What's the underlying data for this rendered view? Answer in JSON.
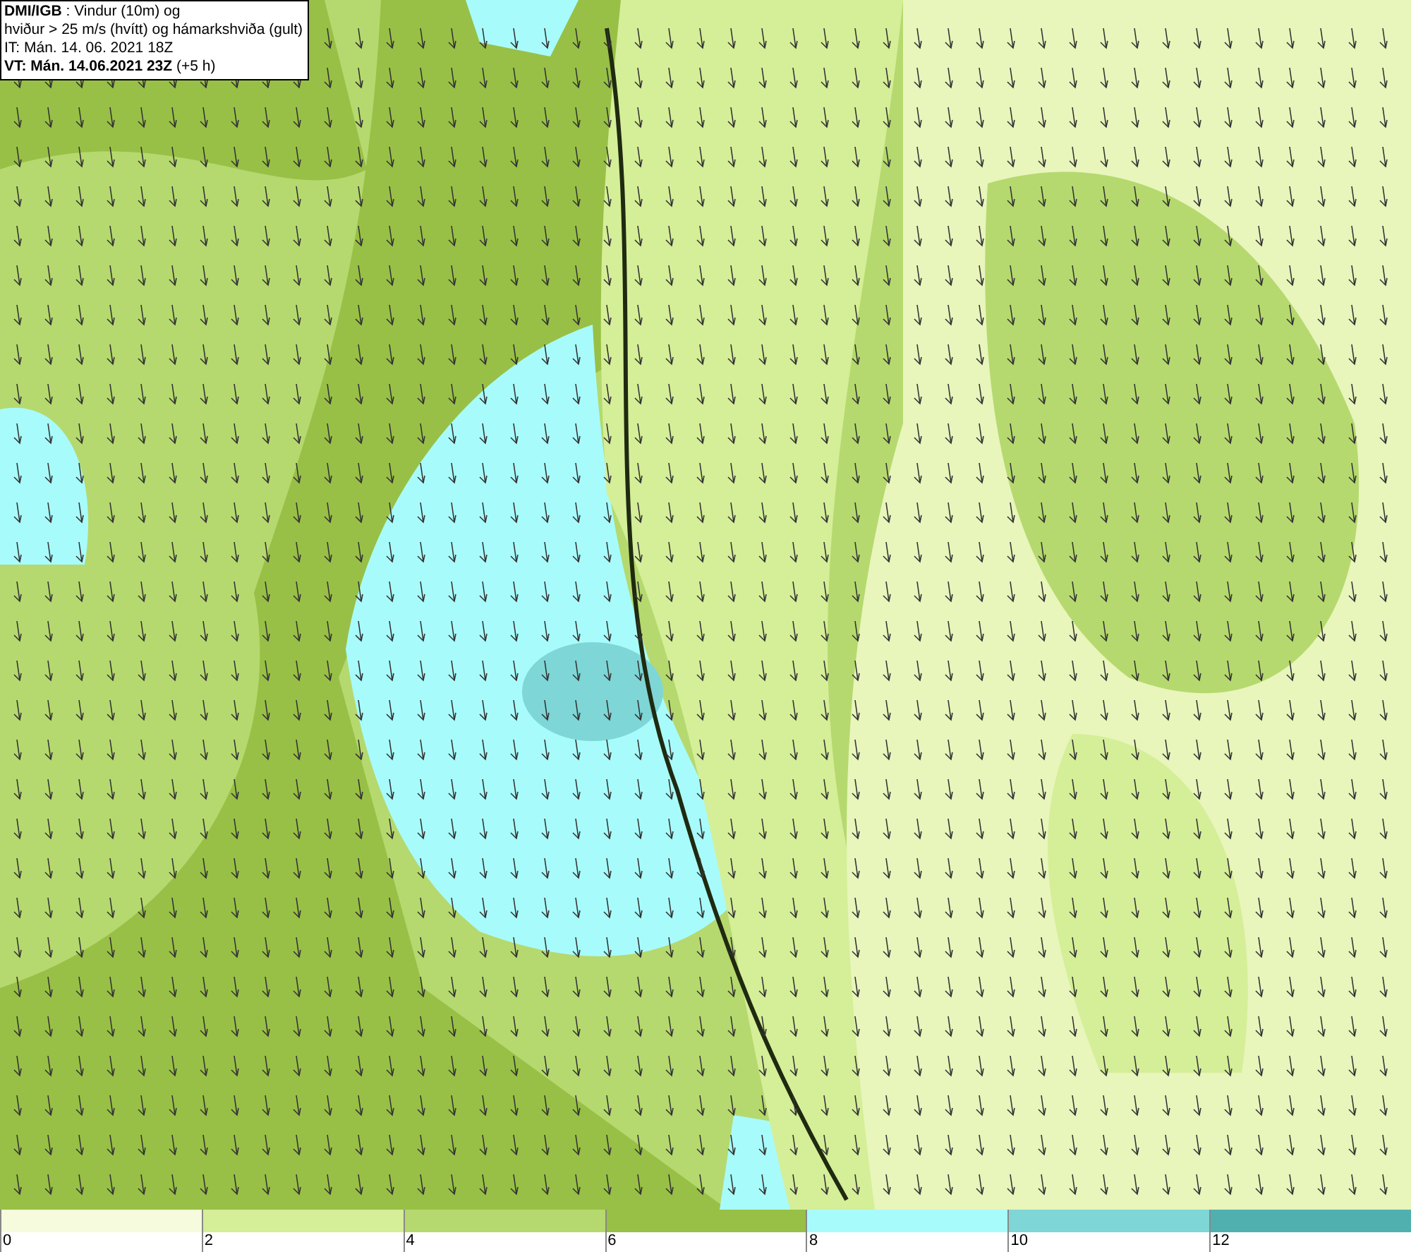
{
  "header": {
    "lines": [
      "**DMI/IGB** : Vindur (10m) og",
      "hviður > 25 m/s (hvítt) og hámarkshviða (gult)",
      "IT: Mán. 14. 06. 2021 18Z",
      "**VT: Mán. 14.06.2021 23Z** (+5 h)"
    ]
  },
  "legend": [
    {
      "label": "0",
      "color": "#f5fbdc"
    },
    {
      "label": "2",
      "color": "#d5ee98"
    },
    {
      "label": "4",
      "color": "#b5d96e"
    },
    {
      "label": "6",
      "color": "#98c046"
    },
    {
      "label": "8",
      "color": "#a8fbfb"
    },
    {
      "label": "10",
      "color": "#7ed6d6"
    },
    {
      "label": "12",
      "color": "#50b0b0"
    }
  ]
}
